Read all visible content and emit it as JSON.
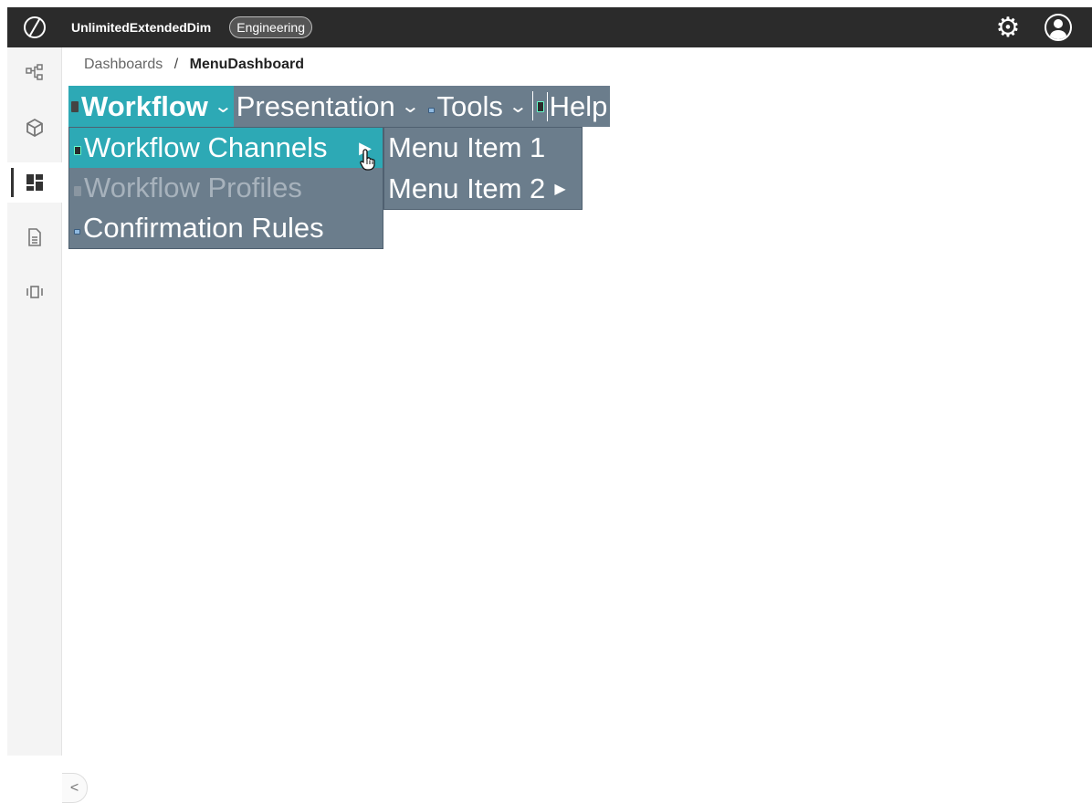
{
  "topbar": {
    "app_name": "UnlimitedExtendedDim",
    "environment": "Engineering"
  },
  "sidebar": {
    "items": [
      {
        "icon": "hierarchy-icon"
      },
      {
        "icon": "cube-icon"
      },
      {
        "icon": "dashboard-icon",
        "active": true
      },
      {
        "icon": "document-icon"
      },
      {
        "icon": "carousel-icon"
      }
    ],
    "collapse_glyph": "<"
  },
  "breadcrumb": {
    "parent": "Dashboards",
    "separator": "/",
    "current": "MenuDashboard"
  },
  "menubar": {
    "items": [
      {
        "label": "Workflow",
        "active": true
      },
      {
        "label": "Presentation"
      },
      {
        "label": "Tools"
      },
      {
        "label": "Help"
      }
    ]
  },
  "dropdown": {
    "items": [
      {
        "label": "Workflow Channels",
        "hover": true
      },
      {
        "label": "Workflow Profiles",
        "disabled": true
      },
      {
        "label": "Confirmation Rules"
      }
    ]
  },
  "submenu": {
    "items": [
      {
        "label": "Menu Item 1"
      },
      {
        "label": "Menu Item 2"
      }
    ]
  },
  "colors": {
    "topbar_bg": "#2b2b2b",
    "menu_bg": "#6b7d8c",
    "menu_active": "#2da9b5"
  }
}
